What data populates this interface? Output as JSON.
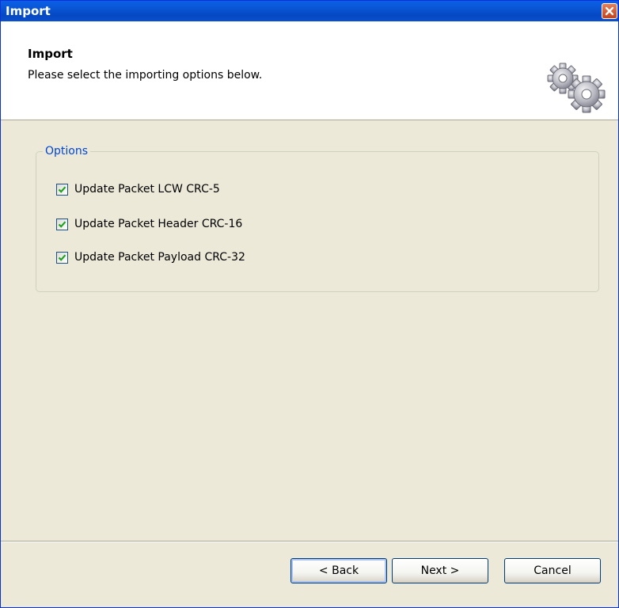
{
  "window": {
    "title": "Import"
  },
  "header": {
    "title": "Import",
    "subtitle": "Please select the importing options below.",
    "icon": "gears-icon"
  },
  "options": {
    "legend": "Options",
    "items": [
      {
        "label": "Update Packet LCW CRC-5",
        "checked": true
      },
      {
        "label": "Update Packet Header CRC-16",
        "checked": true
      },
      {
        "label": "Update Packet Payload CRC-32",
        "checked": true
      }
    ]
  },
  "buttons": {
    "back": "< Back",
    "next": "Next >",
    "cancel": "Cancel"
  },
  "colors": {
    "titlebar": "#0a58d8",
    "legend": "#0046d5",
    "check": "#21a121",
    "background": "#ece9d8"
  }
}
